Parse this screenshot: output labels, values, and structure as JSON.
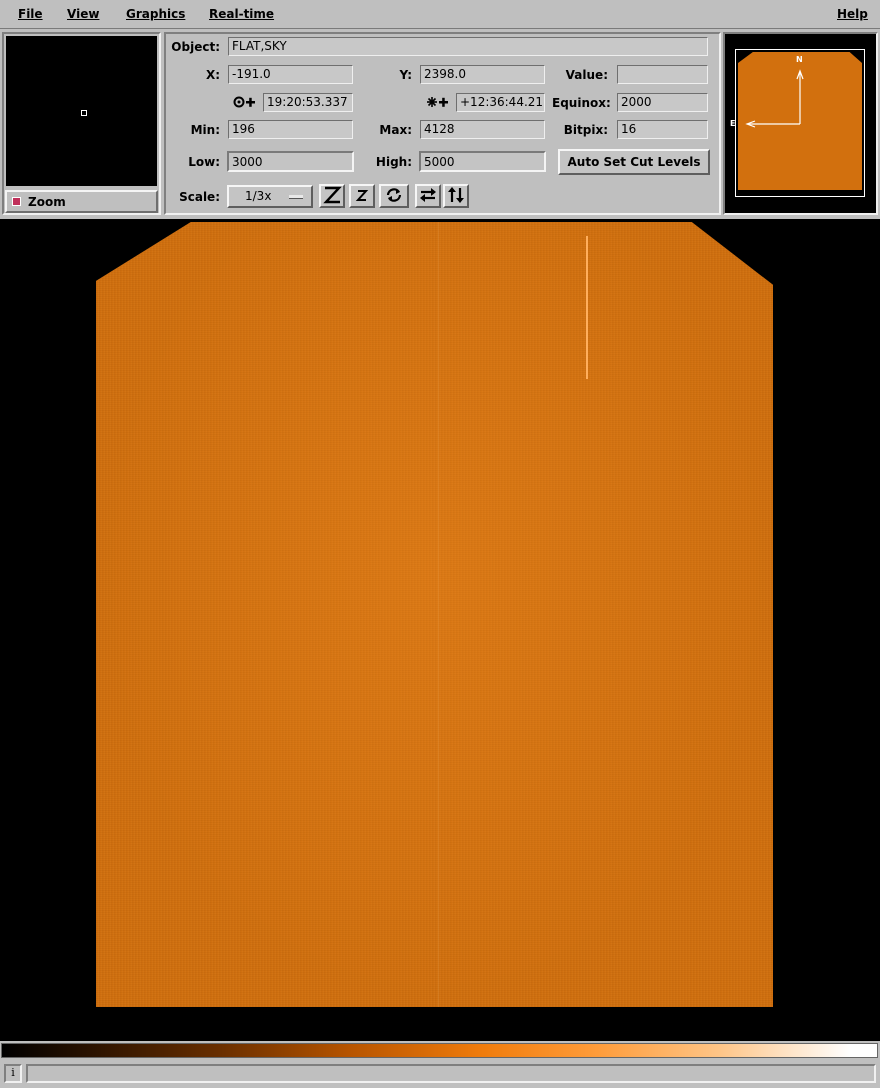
{
  "menubar": {
    "file": "File",
    "view": "View",
    "graphics": "Graphics",
    "realtime": "Real-time",
    "help": "Help"
  },
  "zoom_panel": {
    "toggle_label": "Zoom",
    "toggle_checked": true
  },
  "info": {
    "object_label": "Object:",
    "object_value": "FLAT,SKY",
    "x_label": "X:",
    "x_value": "-191.0",
    "y_label": "Y:",
    "y_value": "2398.0",
    "value_label": "Value:",
    "value_value": "",
    "ra_value": "19:20:53.337",
    "dec_value": "+12:36:44.21",
    "equinox_label": "Equinox:",
    "equinox_value": "2000",
    "min_label": "Min:",
    "min_value": "196",
    "max_label": "Max:",
    "max_value": "4128",
    "bitpix_label": "Bitpix:",
    "bitpix_value": "16",
    "low_label": "Low:",
    "low_value": "3000",
    "high_label": "High:",
    "high_value": "5000",
    "auto_cut_label": "Auto Set Cut Levels",
    "scale_label": "Scale:",
    "scale_value": "1/3x"
  },
  "toolbar_icons": [
    "zoom-fit-icon",
    "zoom-reset-icon",
    "rotate-icon",
    "flip-x-icon",
    "flip-y-icon"
  ],
  "compass": {
    "north": "N",
    "east": "E"
  },
  "colors": {
    "image_orange": "#d2700e",
    "panel_gray": "#bfbfbf"
  }
}
